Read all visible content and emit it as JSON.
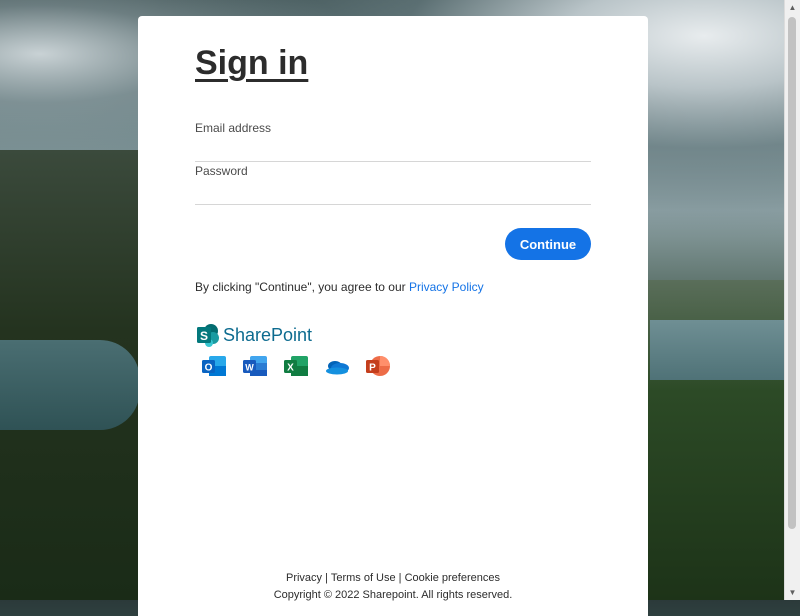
{
  "page": {
    "title": "Sign in"
  },
  "form": {
    "email_label": "Email address",
    "email_value": "",
    "password_label": "Password",
    "password_value": "",
    "continue_label": "Continue"
  },
  "consent": {
    "text": "By clicking \"Continue\", you agree to our ",
    "link_label": "Privacy Policy"
  },
  "brand": {
    "name": "SharePoint",
    "color": "#0d6b8f",
    "apps": [
      {
        "name": "outlook-icon",
        "letter": "O",
        "color": "#0a64c2"
      },
      {
        "name": "word-icon",
        "letter": "W",
        "color": "#185abd"
      },
      {
        "name": "excel-icon",
        "letter": "X",
        "color": "#107c41"
      },
      {
        "name": "onedrive-icon",
        "letter": "",
        "color": "#0f78d4"
      },
      {
        "name": "powerpoint-icon",
        "letter": "P",
        "color": "#c43e1c"
      }
    ]
  },
  "footer": {
    "privacy": "Privacy",
    "sep1": " | ",
    "terms": "Terms of Use",
    "sep2": " | ",
    "cookies": "Cookie preferences",
    "copyright": "Copyright © 2022 Sharepoint. All rights reserved."
  },
  "colors": {
    "accent": "#1473e6"
  }
}
